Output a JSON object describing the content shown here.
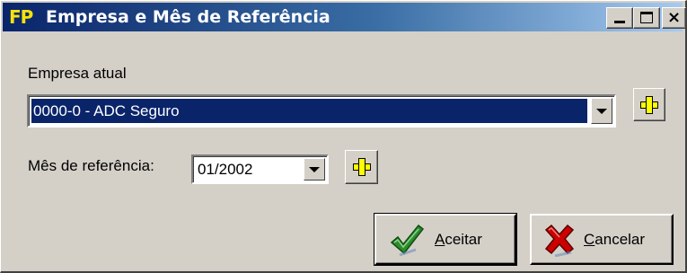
{
  "window": {
    "title": "Empresa e Mês de Referência",
    "app_icon_text": "FP",
    "controls": {
      "minimize": "minimize-icon",
      "maximize": "maximize-icon",
      "close": "close-icon",
      "close_glyph": "×"
    }
  },
  "form": {
    "company_label": "Empresa atual",
    "company_value": "0000-0 - ADC Seguro",
    "month_label": "Mês de referência:",
    "month_value": "01/2002"
  },
  "buttons": {
    "accept": {
      "mnemonic": "A",
      "rest": "ceitar",
      "icon": "checkmark-icon"
    },
    "cancel": {
      "mnemonic": "C",
      "rest": "ancelar",
      "icon": "x-icon"
    },
    "add_icon": "plus-icon"
  },
  "colors": {
    "title_bar": "#0a246a",
    "selection": "#0a246a",
    "face": "#d4d0c8",
    "plus": "#ffff00",
    "accept_icon": "#2e8b2e",
    "cancel_icon": "#cc0000"
  }
}
